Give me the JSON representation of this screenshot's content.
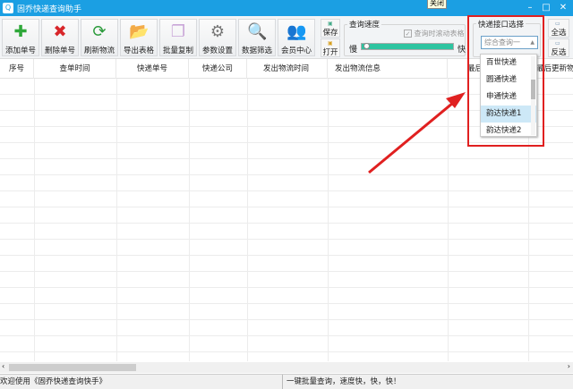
{
  "window": {
    "title": "固乔快递查询助手",
    "tooltip": "关闭",
    "minimize": "–",
    "maximize": "□",
    "close": "✕"
  },
  "toolbar": {
    "buttons": [
      {
        "label": "添加单号",
        "icon": "plus-icon",
        "glyph": "✚",
        "color": "#2fa83a"
      },
      {
        "label": "删除单号",
        "icon": "delete-icon",
        "glyph": "✖",
        "color": "#d8262a"
      },
      {
        "label": "刷新物流",
        "icon": "refresh-icon",
        "glyph": "⟳",
        "color": "#2a9a3a"
      },
      {
        "label": "导出表格",
        "icon": "folder-export-icon",
        "glyph": "📂",
        "color": "#e8b020"
      },
      {
        "label": "批量复制",
        "icon": "copy-icon",
        "glyph": "❐",
        "color": "#c9a6d8"
      },
      {
        "label": "参数设置",
        "icon": "gear-icon",
        "glyph": "⚙",
        "color": "#777777"
      },
      {
        "label": "数据筛选",
        "icon": "search-filter-icon",
        "glyph": "🔍",
        "color": "#e2a81c"
      },
      {
        "label": "会员中心",
        "icon": "members-icon",
        "glyph": "👥",
        "color": "#c04040"
      }
    ],
    "save": "保存",
    "open": "打开",
    "select_all": "全选",
    "invert": "反选"
  },
  "speed": {
    "label": "查询速度",
    "slow": "慢",
    "fast": "快",
    "value_percent": 5,
    "scroll_checkbox": "查询时滚动表格",
    "scroll_checked": true
  },
  "api": {
    "label": "快递接口选择",
    "selected": "综合查询一",
    "options": [
      "百世快递",
      "圆通快递",
      "申通快递",
      "韵达快递1",
      "韵达快递2"
    ],
    "highlighted": "韵达快递1"
  },
  "table": {
    "columns": [
      "序号",
      "查单时间",
      "快递单号",
      "快递公司",
      "发出物流时间",
      "发出物流信息",
      "最后",
      "最后更新物流"
    ]
  },
  "status": {
    "left": "欢迎使用《固乔快递查询快手》",
    "right": "一键批量查询，速度快，快，快！"
  },
  "colors": {
    "titlebar": "#1b9fe3",
    "highlight_box": "#e02020",
    "slider": "#2ec4a0"
  }
}
